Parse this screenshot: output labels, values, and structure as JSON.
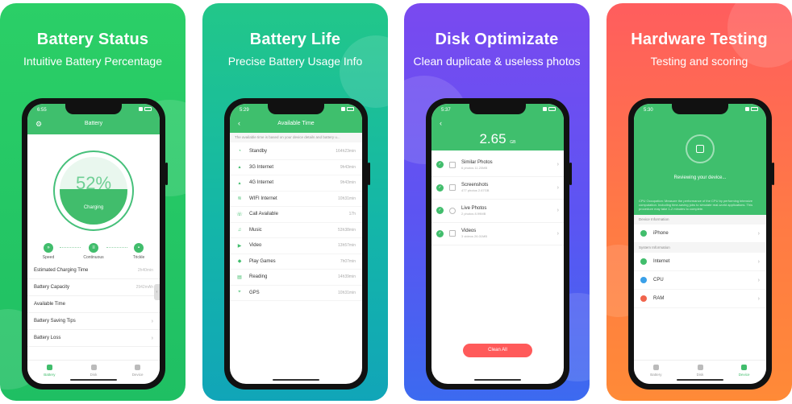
{
  "panels": [
    {
      "heading": "Battery Status",
      "subheading": "Intuitive Battery Percentage",
      "status_time": "6:55",
      "screen_title": "Battery",
      "gauge": {
        "percent": "52%",
        "level": 0.52,
        "state": "Charging"
      },
      "modes": [
        "Speed",
        "Continuous",
        "Trickle"
      ],
      "rows": [
        {
          "label": "Estimated Charging Time",
          "value": "2h40min"
        },
        {
          "label": "Battery Capacity",
          "value": "2942mAh"
        },
        {
          "label": "Available Time",
          "value": ""
        },
        {
          "label": "Battery Saving Tips",
          "value": ""
        },
        {
          "label": "Battery Loss",
          "value": ""
        }
      ],
      "tabs": [
        "Battery",
        "Disk",
        "Device"
      ]
    },
    {
      "heading": "Battery Life",
      "subheading": "Precise Battery Usage Info",
      "status_time": "5:29",
      "screen_title": "Available Time",
      "note": "The available time is based on your device details and battery u...",
      "rows": [
        {
          "icon": "standby-icon",
          "label": "Standby",
          "value": "164h23min"
        },
        {
          "icon": "3g-icon",
          "label": "3G Internet",
          "value": "9h43min"
        },
        {
          "icon": "4g-icon",
          "label": "4G Internet",
          "value": "9h43min"
        },
        {
          "icon": "wifi-icon",
          "label": "WIFI Internet",
          "value": "10h31min"
        },
        {
          "icon": "call-icon",
          "label": "Call Available",
          "value": "17h"
        },
        {
          "icon": "music-icon",
          "label": "Music",
          "value": "53h38min"
        },
        {
          "icon": "video-icon",
          "label": "Video",
          "value": "13h57min"
        },
        {
          "icon": "game-icon",
          "label": "Play Games",
          "value": "7h07min"
        },
        {
          "icon": "reading-icon",
          "label": "Reading",
          "value": "14h39min"
        },
        {
          "icon": "gps-icon",
          "label": "GPS",
          "value": "10h31min"
        }
      ]
    },
    {
      "heading": "Disk Optimizate",
      "subheading": "Clean duplicate & useless photos",
      "status_time": "5:37",
      "size_value": "2.65",
      "size_unit": "GB",
      "rows": [
        {
          "label": "Similar Photos",
          "detail": "6 photos   11.20MB"
        },
        {
          "label": "Screenshots",
          "detail": "477 photos   2.67GB"
        },
        {
          "label": "Live Photos",
          "detail": "2 photos   8.99MB"
        },
        {
          "label": "Videos",
          "detail": "3 videos   26.01MB"
        }
      ],
      "clean_button": "Clean All"
    },
    {
      "heading": "Hardware Testing",
      "subheading": "Testing and scoring",
      "status_time": "5:30",
      "reviewing": "Reviewing your device...",
      "tiny_text": "CPU Occupation: Measure the performance of the CPU by performing intensive computation. Including time-saving jobs to simulate real-world applications. This procedure may take 1-2 minutes to complete.",
      "section_device": "Device Information",
      "device_rows": [
        "iPhone"
      ],
      "section_system": "System Information",
      "system_rows": [
        "Internet",
        "CPU",
        "RAM"
      ],
      "tabs": [
        "Battery",
        "Disk",
        "Device"
      ]
    }
  ],
  "colors": {
    "green": "#41bd6c",
    "red_button": "#ff5a5a"
  }
}
